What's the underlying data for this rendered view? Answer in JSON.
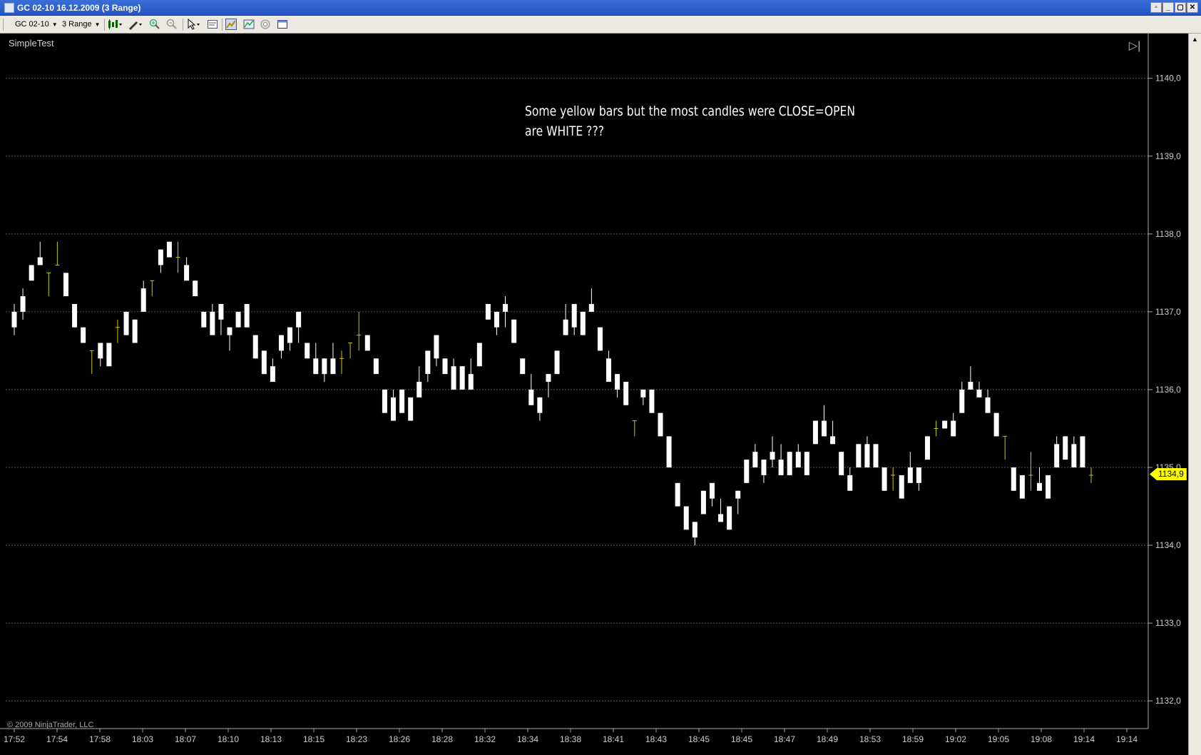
{
  "window": {
    "title": "GC 02-10  16.12.2009 (3 Range)",
    "buttons": [
      "restore",
      "minimize",
      "maximize",
      "close"
    ]
  },
  "toolbar": {
    "instrument": "GC 02-10",
    "interval": "3 Range",
    "icons": [
      "candlestick-style-icon",
      "pencil-draw-icon",
      "zoom-in-icon",
      "zoom-out-icon",
      "pointer-icon",
      "properties-icon",
      "indicator-icon",
      "strategy-icon",
      "crosshair-icon",
      "data-box-icon"
    ]
  },
  "chart": {
    "indicator_label": "SimpleTest",
    "annotation": "Some yellow bars but the most candles were CLOSE=OPEN\nare WHITE ???",
    "copyright": "© 2009 NinjaTrader, LLC",
    "current_price": "1134,9",
    "colors": {
      "background": "#000000",
      "candle": "#ffffff",
      "doji": "#c8c800",
      "marker": "#ffff00"
    }
  },
  "chart_data": {
    "type": "candlestick",
    "y_ticks": [
      "1140,0",
      "1139,0",
      "1138,0",
      "1137,0",
      "1136,0",
      "1135,0",
      "1134,0",
      "1133,0",
      "1132,0"
    ],
    "ylim": [
      1131.8,
      1140.3
    ],
    "x_labels": [
      "17:52",
      "17:54",
      "17:58",
      "18:03",
      "18:07",
      "18:10",
      "18:13",
      "18:15",
      "18:23",
      "18:26",
      "18:28",
      "18:32",
      "18:34",
      "18:38",
      "18:41",
      "18:43",
      "18:45",
      "18:45",
      "18:47",
      "18:49",
      "18:53",
      "18:59",
      "19:02",
      "19:05",
      "19:08",
      "19:14",
      "19:14"
    ],
    "grid": true,
    "candles": [
      [
        1137.0,
        1136.8,
        1136.7,
        1137.1
      ],
      [
        1137.2,
        1137.0,
        1136.9,
        1137.3
      ],
      [
        1137.6,
        1137.4,
        1137.4,
        1137.6
      ],
      [
        1137.7,
        1137.6,
        1137.6,
        1137.9
      ],
      [
        1137.5,
        1137.5,
        1137.2,
        1137.5
      ],
      [
        1137.6,
        1137.6,
        1137.6,
        1137.9
      ],
      [
        1137.5,
        1137.2,
        1137.2,
        1137.5
      ],
      [
        1137.1,
        1136.8,
        1136.8,
        1137.1
      ],
      [
        1136.8,
        1136.6,
        1136.6,
        1136.8
      ],
      [
        1136.5,
        1136.5,
        1136.2,
        1136.5
      ],
      [
        1136.6,
        1136.4,
        1136.3,
        1136.6
      ],
      [
        1136.6,
        1136.3,
        1136.3,
        1136.6
      ],
      [
        1136.8,
        1136.8,
        1136.6,
        1136.9
      ],
      [
        1137.0,
        1136.7,
        1136.7,
        1137.0
      ],
      [
        1136.9,
        1136.6,
        1136.6,
        1136.9
      ],
      [
        1137.3,
        1137.0,
        1137.0,
        1137.4
      ],
      [
        1137.4,
        1137.4,
        1137.2,
        1137.4
      ],
      [
        1137.8,
        1137.6,
        1137.5,
        1137.8
      ],
      [
        1137.9,
        1137.7,
        1137.7,
        1137.9
      ],
      [
        1137.7,
        1137.7,
        1137.5,
        1137.9
      ],
      [
        1137.6,
        1137.4,
        1137.4,
        1137.7
      ],
      [
        1137.4,
        1137.2,
        1137.2,
        1137.4
      ],
      [
        1137.0,
        1136.8,
        1136.8,
        1137.0
      ],
      [
        1137.0,
        1136.7,
        1136.7,
        1137.1
      ],
      [
        1137.1,
        1136.9,
        1136.7,
        1137.1
      ],
      [
        1136.8,
        1136.7,
        1136.5,
        1136.8
      ],
      [
        1137.0,
        1136.8,
        1136.8,
        1137.0
      ],
      [
        1137.1,
        1136.8,
        1136.8,
        1137.1
      ],
      [
        1136.7,
        1136.4,
        1136.4,
        1136.7
      ],
      [
        1136.5,
        1136.2,
        1136.2,
        1136.5
      ],
      [
        1136.3,
        1136.1,
        1136.1,
        1136.4
      ],
      [
        1136.5,
        1136.7,
        1136.4,
        1136.7
      ],
      [
        1136.8,
        1136.6,
        1136.5,
        1136.8
      ],
      [
        1137.0,
        1136.8,
        1136.6,
        1137.0
      ],
      [
        1136.6,
        1136.4,
        1136.4,
        1136.6
      ],
      [
        1136.2,
        1136.4,
        1136.2,
        1136.6
      ],
      [
        1136.4,
        1136.2,
        1136.1,
        1136.4
      ],
      [
        1136.2,
        1136.4,
        1136.2,
        1136.6
      ],
      [
        1136.4,
        1136.4,
        1136.2,
        1136.5
      ],
      [
        1136.6,
        1136.6,
        1136.4,
        1136.6
      ],
      [
        1136.7,
        1136.7,
        1136.5,
        1137.0
      ],
      [
        1136.7,
        1136.5,
        1136.5,
        1136.7
      ],
      [
        1136.4,
        1136.2,
        1136.2,
        1136.4
      ],
      [
        1136.0,
        1135.7,
        1135.7,
        1136.0
      ],
      [
        1135.9,
        1135.6,
        1135.6,
        1136.0
      ],
      [
        1136.0,
        1135.7,
        1135.7,
        1136.0
      ],
      [
        1135.9,
        1135.6,
        1135.6,
        1135.9
      ],
      [
        1135.9,
        1136.1,
        1135.9,
        1136.3
      ],
      [
        1136.2,
        1136.5,
        1136.1,
        1136.5
      ],
      [
        1136.7,
        1136.4,
        1136.3,
        1136.7
      ],
      [
        1136.4,
        1136.2,
        1136.2,
        1136.4
      ],
      [
        1136.3,
        1136.0,
        1136.0,
        1136.4
      ],
      [
        1136.3,
        1136.0,
        1136.0,
        1136.3
      ],
      [
        1136.2,
        1136.0,
        1136.0,
        1136.4
      ],
      [
        1136.3,
        1136.6,
        1136.3,
        1136.6
      ],
      [
        1136.9,
        1137.1,
        1136.9,
        1137.1
      ],
      [
        1137.0,
        1136.8,
        1136.7,
        1137.0
      ],
      [
        1137.0,
        1137.1,
        1136.8,
        1137.2
      ],
      [
        1136.9,
        1136.6,
        1136.6,
        1136.9
      ],
      [
        1136.4,
        1136.2,
        1136.2,
        1136.4
      ],
      [
        1136.0,
        1135.8,
        1135.8,
        1136.2
      ],
      [
        1135.9,
        1135.7,
        1135.6,
        1135.9
      ],
      [
        1136.2,
        1136.1,
        1135.9,
        1136.2
      ],
      [
        1136.5,
        1136.2,
        1136.2,
        1136.5
      ],
      [
        1136.9,
        1136.7,
        1136.7,
        1137.1
      ],
      [
        1137.1,
        1136.8,
        1136.7,
        1137.1
      ],
      [
        1137.0,
        1136.7,
        1136.7,
        1137.0
      ],
      [
        1137.1,
        1137.0,
        1137.0,
        1137.3
      ],
      [
        1136.8,
        1136.5,
        1136.5,
        1136.8
      ],
      [
        1136.4,
        1136.1,
        1136.1,
        1136.5
      ],
      [
        1136.2,
        1136.0,
        1135.9,
        1136.2
      ],
      [
        1136.1,
        1135.8,
        1135.8,
        1136.1
      ],
      [
        1135.6,
        1135.6,
        1135.4,
        1135.6
      ],
      [
        1136.0,
        1135.9,
        1135.8,
        1136.0
      ],
      [
        1136.0,
        1135.7,
        1135.7,
        1136.0
      ],
      [
        1135.7,
        1135.4,
        1135.4,
        1135.7
      ],
      [
        1135.4,
        1135.0,
        1135.0,
        1135.4
      ],
      [
        1134.8,
        1134.5,
        1134.5,
        1134.8
      ],
      [
        1134.5,
        1134.2,
        1134.2,
        1134.5
      ],
      [
        1134.3,
        1134.1,
        1134.0,
        1134.3
      ],
      [
        1134.7,
        1134.4,
        1134.4,
        1134.7
      ],
      [
        1134.8,
        1134.6,
        1134.5,
        1134.8
      ],
      [
        1134.4,
        1134.3,
        1134.3,
        1134.6
      ],
      [
        1134.5,
        1134.2,
        1134.2,
        1134.5
      ],
      [
        1134.7,
        1134.6,
        1134.4,
        1134.7
      ],
      [
        1134.8,
        1135.1,
        1134.8,
        1135.1
      ],
      [
        1135.0,
        1135.2,
        1135.0,
        1135.3
      ],
      [
        1134.9,
        1135.1,
        1134.8,
        1135.1
      ],
      [
        1135.2,
        1135.1,
        1135.0,
        1135.4
      ],
      [
        1135.1,
        1134.9,
        1134.9,
        1135.3
      ],
      [
        1135.2,
        1134.9,
        1134.9,
        1135.2
      ],
      [
        1135.2,
        1135.0,
        1135.0,
        1135.3
      ],
      [
        1135.2,
        1134.9,
        1134.9,
        1135.2
      ],
      [
        1135.3,
        1135.6,
        1135.3,
        1135.6
      ],
      [
        1135.4,
        1135.6,
        1135.4,
        1135.8
      ],
      [
        1135.4,
        1135.3,
        1135.3,
        1135.6
      ],
      [
        1135.2,
        1134.9,
        1134.9,
        1135.2
      ],
      [
        1134.9,
        1134.7,
        1134.7,
        1135.0
      ],
      [
        1135.0,
        1135.3,
        1135.0,
        1135.3
      ],
      [
        1135.0,
        1135.3,
        1135.0,
        1135.4
      ],
      [
        1135.3,
        1135.0,
        1135.0,
        1135.3
      ],
      [
        1135.0,
        1134.7,
        1134.7,
        1135.0
      ],
      [
        1134.9,
        1134.9,
        1134.7,
        1135.0
      ],
      [
        1134.9,
        1134.6,
        1134.6,
        1134.9
      ],
      [
        1135.0,
        1134.8,
        1134.8,
        1135.2
      ],
      [
        1134.8,
        1135.0,
        1134.7,
        1135.0
      ],
      [
        1135.1,
        1135.4,
        1135.1,
        1135.4
      ],
      [
        1135.5,
        1135.5,
        1135.4,
        1135.6
      ],
      [
        1135.6,
        1135.5,
        1135.5,
        1135.6
      ],
      [
        1135.6,
        1135.4,
        1135.4,
        1135.7
      ],
      [
        1135.7,
        1136.0,
        1135.7,
        1136.1
      ],
      [
        1136.0,
        1136.1,
        1136.0,
        1136.3
      ],
      [
        1136.0,
        1135.9,
        1135.9,
        1136.1
      ],
      [
        1135.9,
        1135.7,
        1135.7,
        1136.0
      ],
      [
        1135.7,
        1135.4,
        1135.4,
        1135.7
      ],
      [
        1135.4,
        1135.4,
        1135.1,
        1135.4
      ],
      [
        1135.0,
        1134.7,
        1134.7,
        1135.0
      ],
      [
        1134.9,
        1134.6,
        1134.6,
        1134.9
      ],
      [
        1134.9,
        1134.9,
        1134.7,
        1135.2
      ],
      [
        1134.8,
        1134.7,
        1134.7,
        1135.0
      ],
      [
        1134.9,
        1134.6,
        1134.6,
        1134.9
      ],
      [
        1135.3,
        1135.0,
        1135.0,
        1135.4
      ],
      [
        1135.1,
        1135.4,
        1135.1,
        1135.4
      ],
      [
        1135.0,
        1135.3,
        1135.0,
        1135.4
      ],
      [
        1135.0,
        1135.4,
        1135.0,
        1135.4
      ],
      [
        1134.9,
        1134.9,
        1134.8,
        1135.0
      ]
    ]
  }
}
